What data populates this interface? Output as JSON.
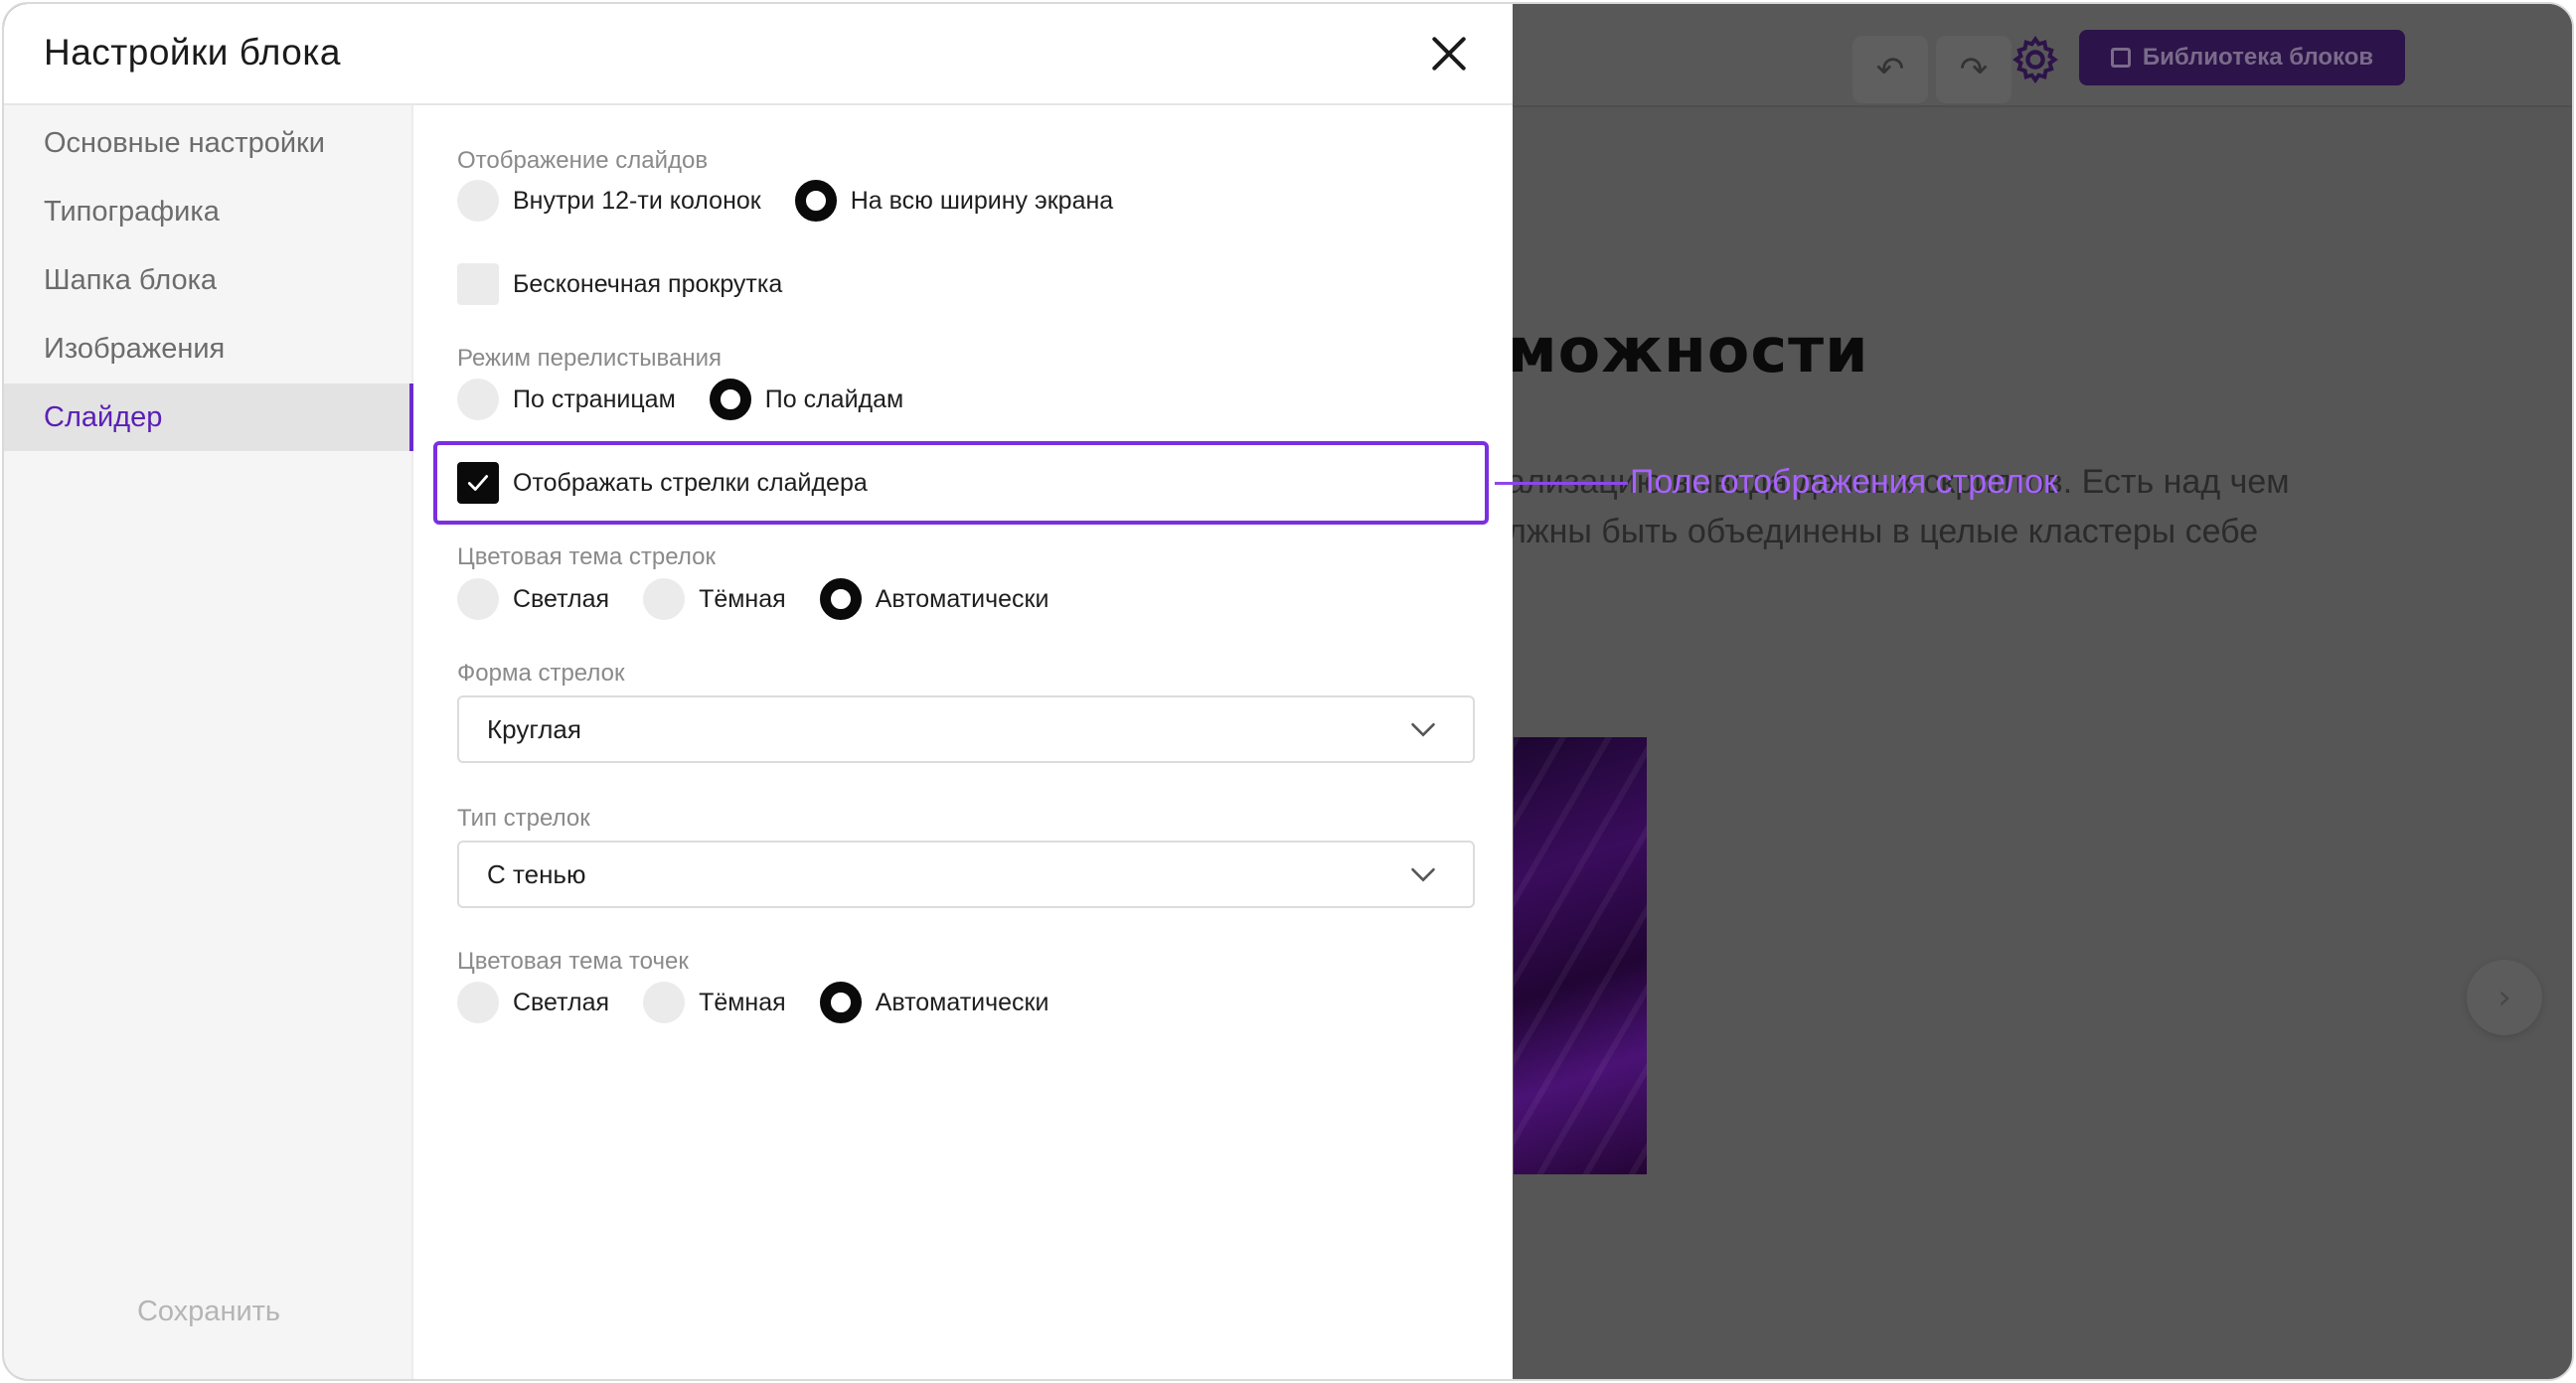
{
  "background": {
    "library_button": "Библиотека блоков",
    "heading": "можности",
    "text_line1": "ализацию вывода данных  скриптов. Есть над чем",
    "text_line2": "лжны быть объединены в целые кластеры себе",
    "next_arrow": "›",
    "undo_icon": "↶",
    "redo_icon": "↷"
  },
  "modal": {
    "title": "Настройки блока",
    "sidebar": {
      "items": [
        {
          "label": "Основные настройки",
          "active": false
        },
        {
          "label": "Типографика",
          "active": false
        },
        {
          "label": "Шапка блока",
          "active": false
        },
        {
          "label": "Изображения",
          "active": false
        },
        {
          "label": "Слайдер",
          "active": true
        }
      ],
      "save_label": "Сохранить"
    },
    "slides_display": {
      "label": "Отображение слайдов",
      "options": [
        "Внутри 12-ти колонок",
        "На всю ширину экрана"
      ],
      "selected": "На всю ширину экрана"
    },
    "infinite_scroll": {
      "label": "Бесконечная прокрутка",
      "checked": false
    },
    "paging_mode": {
      "label": "Режим перелистывания",
      "options": [
        "По страницам",
        "По слайдам"
      ],
      "selected": "По слайдам"
    },
    "show_arrows": {
      "label": "Отображать стрелки слайдера",
      "checked": true
    },
    "callout": {
      "text": "Поле отображения стрелок",
      "color": "#a862ff"
    },
    "arrows_theme": {
      "label": "Цветовая тема стрелок",
      "options": [
        "Светлая",
        "Тёмная",
        "Автоматически"
      ],
      "selected": "Автоматически"
    },
    "arrows_shape": {
      "label": "Форма стрелок",
      "value": "Круглая"
    },
    "arrows_type": {
      "label": "Тип стрелок",
      "value": "С тенью"
    },
    "dots_theme": {
      "label": "Цветовая тема точек",
      "options": [
        "Светлая",
        "Тёмная",
        "Автоматически"
      ],
      "selected": "Автоматически"
    }
  },
  "colors": {
    "accent": "#6a2bd0",
    "highlight_border": "#7a2fe0"
  }
}
